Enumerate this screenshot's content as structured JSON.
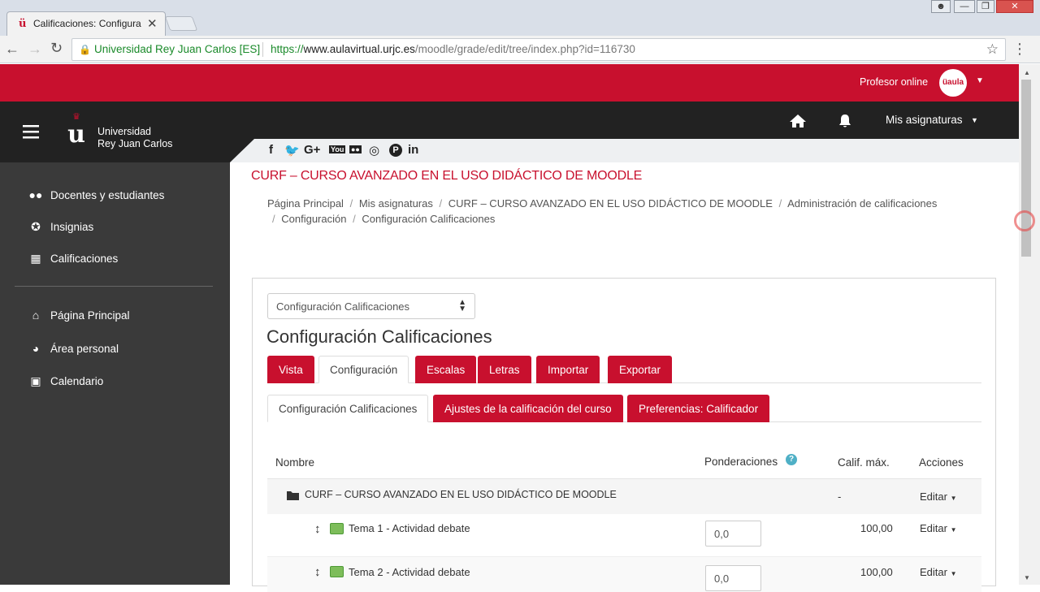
{
  "browser": {
    "tab_title": "Calificaciones: Configura",
    "favicon": "ü",
    "close_tab": "✕",
    "security_label": "Universidad Rey Juan Carlos [ES]",
    "url_scheme": "https://",
    "url_host": "www.aulavirtual.urjc.es",
    "url_path": "/moodle/grade/edit/tree/index.php?id=116730",
    "back_icon": "←",
    "forward_icon": "→",
    "reload_icon": "↻",
    "star_icon": "☆",
    "menu_icon": "⋮"
  },
  "topbar": {
    "user_name": "Profesor online",
    "avatar_text": "üaula"
  },
  "nav": {
    "university_line1": "Universidad",
    "university_line2": "Rey Juan Carlos",
    "my_courses": "Mis asignaturas",
    "home_icon": "home-icon",
    "bell_icon": "bell-icon"
  },
  "sidebar": {
    "items": [
      {
        "label": "Docentes y estudiantes",
        "icon": "users-icon"
      },
      {
        "label": "Insignias",
        "icon": "badge-icon"
      },
      {
        "label": "Calificaciones",
        "icon": "table-icon"
      },
      {
        "label": "Página Principal",
        "icon": "home-icon"
      },
      {
        "label": "Área personal",
        "icon": "dashboard-icon"
      },
      {
        "label": "Calendario",
        "icon": "calendar-icon"
      }
    ]
  },
  "social": [
    "f",
    "t",
    "G+",
    "You",
    "●●",
    "◎",
    "P",
    "in"
  ],
  "course": {
    "title": "CURF – CURSO AVANZADO EN EL USO DIDÁCTICO DE MOODLE"
  },
  "breadcrumb": [
    "Página Principal",
    "Mis asignaturas",
    "CURF – CURSO AVANZADO EN EL USO DIDÁCTICO DE MOODLE",
    "Administración de calificaciones",
    "Configuración",
    "Configuración Calificaciones"
  ],
  "page": {
    "select_value": "Configuración Calificaciones",
    "heading": "Configuración Calificaciones"
  },
  "tabs": [
    "Vista",
    "Configuración",
    "Escalas",
    "Letras",
    "Importar",
    "Exportar"
  ],
  "subtabs": [
    "Configuración Calificaciones",
    "Ajustes de la calificación del curso",
    "Preferencias: Calificador"
  ],
  "table": {
    "headers": {
      "name": "Nombre",
      "weights": "Ponderaciones",
      "max": "Calif. máx.",
      "actions": "Acciones"
    },
    "category": {
      "name": "CURF – CURSO AVANZADO EN EL USO DIDÁCTICO DE MOODLE",
      "max": "-",
      "action": "Editar"
    },
    "rows": [
      {
        "name": "Tema 1 - Actividad debate",
        "weight": "0,0",
        "max": "100,00",
        "action": "Editar"
      },
      {
        "name": "Tema 2 - Actividad debate",
        "weight": "0,0",
        "max": "100,00",
        "action": "Editar"
      }
    ]
  },
  "colors": {
    "brand": "#c8102e",
    "dark": "#222222",
    "sidebar": "#3a3a3a"
  }
}
